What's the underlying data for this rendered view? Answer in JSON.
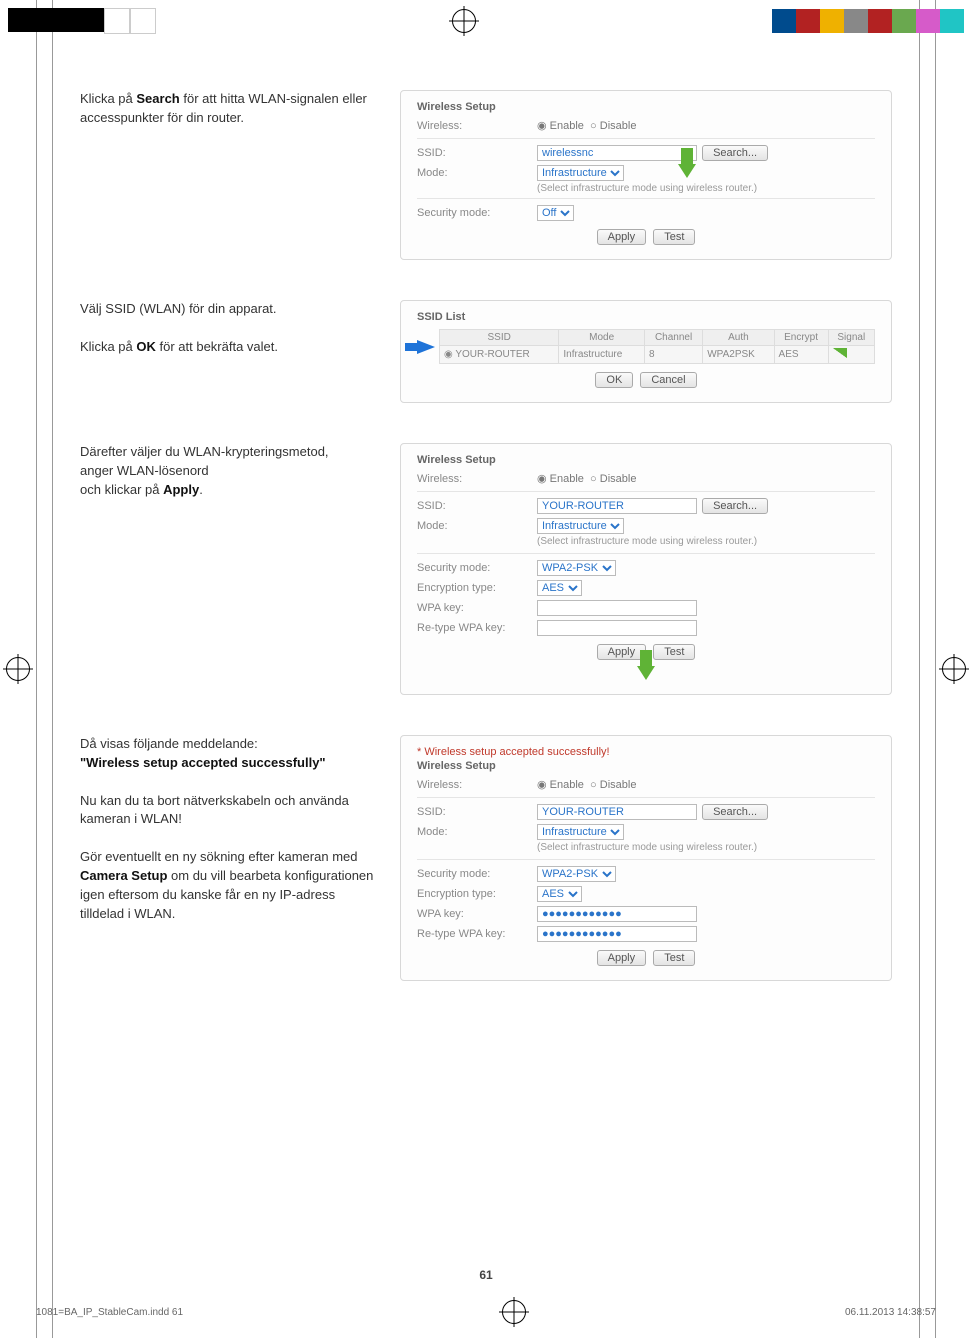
{
  "crop_colors_left": [
    "#000000",
    "#000000",
    "#000000",
    "#000000",
    "#ffffff",
    "#ffffff"
  ],
  "crop_colors_right": [
    "#004b8d",
    "#b22222",
    "#efb100",
    "#888888",
    "#b22222",
    "#6aa84f",
    "#b452c0",
    "#20c5c5"
  ],
  "instructions": {
    "step1_pre": "Klicka på ",
    "step1_bold": "Search",
    "step1_post": " för att hitta WLAN-signalen eller accesspunkter för din router.",
    "step2a": "Välj SSID (WLAN) för din apparat.",
    "step2b_pre": "Klicka på ",
    "step2b_bold": "OK",
    "step2b_post": " för att bekräfta valet.",
    "step3_l1": "Därefter väljer du WLAN-krypteringsmetod,",
    "step3_l2": "anger WLAN-lösenord",
    "step3_l3_pre": "och klickar på ",
    "step3_l3_bold": "Apply",
    "step3_l3_post": ".",
    "step4_l1": "Då visas följande meddelande:",
    "step4_l2": "\"Wireless setup accepted successfully\"",
    "step4_l3": "Nu kan du ta bort nätverkskabeln och använda kameran i WLAN!",
    "step4_l4_pre": "Gör eventuellt en ny sökning efter kameran med ",
    "step4_l4_bold": "Camera Setup",
    "step4_l4_post": " om du vill bearbeta konfigurationen igen eftersom du kanske får en ny IP-adress tilldelad i WLAN."
  },
  "panel1": {
    "title": "Wireless Setup",
    "labels": {
      "wireless": "Wireless:",
      "ssid": "SSID:",
      "mode": "Mode:",
      "security": "Security mode:"
    },
    "radio_enable": "Enable",
    "radio_disable": "Disable",
    "ssid_value": "wirelessnc",
    "mode_value": "Infrastructure",
    "note": "(Select infrastructure mode using wireless router.)",
    "security_value": "Off",
    "btn_search": "Search...",
    "btn_apply": "Apply",
    "btn_test": "Test"
  },
  "panel2": {
    "title": "SSID List",
    "headers": [
      "SSID",
      "Mode",
      "Channel",
      "Auth",
      "Encrypt",
      "Signal"
    ],
    "row": {
      "ssid": "YOUR-ROUTER",
      "mode": "Infrastructure",
      "channel": "8",
      "auth": "WPA2PSK",
      "encrypt": "AES"
    },
    "btn_ok": "OK",
    "btn_cancel": "Cancel"
  },
  "panel3": {
    "title": "Wireless Setup",
    "labels": {
      "wireless": "Wireless:",
      "ssid": "SSID:",
      "mode": "Mode:",
      "security": "Security mode:",
      "enc": "Encryption type:",
      "wpa": "WPA key:",
      "rewpa": "Re-type WPA key:"
    },
    "radio_enable": "Enable",
    "radio_disable": "Disable",
    "ssid_value": "YOUR-ROUTER",
    "mode_value": "Infrastructure",
    "note": "(Select infrastructure mode using wireless router.)",
    "security_value": "WPA2-PSK",
    "enc_value": "AES",
    "btn_search": "Search...",
    "btn_apply": "Apply",
    "btn_test": "Test"
  },
  "panel4": {
    "success": "* Wireless setup accepted successfully!",
    "title": "Wireless Setup",
    "labels": {
      "wireless": "Wireless:",
      "ssid": "SSID:",
      "mode": "Mode:",
      "security": "Security mode:",
      "enc": "Encryption type:",
      "wpa": "WPA key:",
      "rewpa": "Re-type WPA key:"
    },
    "radio_enable": "Enable",
    "radio_disable": "Disable",
    "ssid_value": "YOUR-ROUTER",
    "mode_value": "Infrastructure",
    "note": "(Select infrastructure mode using wireless router.)",
    "security_value": "WPA2-PSK",
    "enc_value": "AES",
    "wpa_value": "●●●●●●●●●●●●",
    "btn_search": "Search...",
    "btn_apply": "Apply",
    "btn_test": "Test"
  },
  "page_number": "61",
  "footer": {
    "file": "1081=BA_IP_StableCam.indd   61",
    "timestamp": "06.11.2013   14:38:57"
  }
}
